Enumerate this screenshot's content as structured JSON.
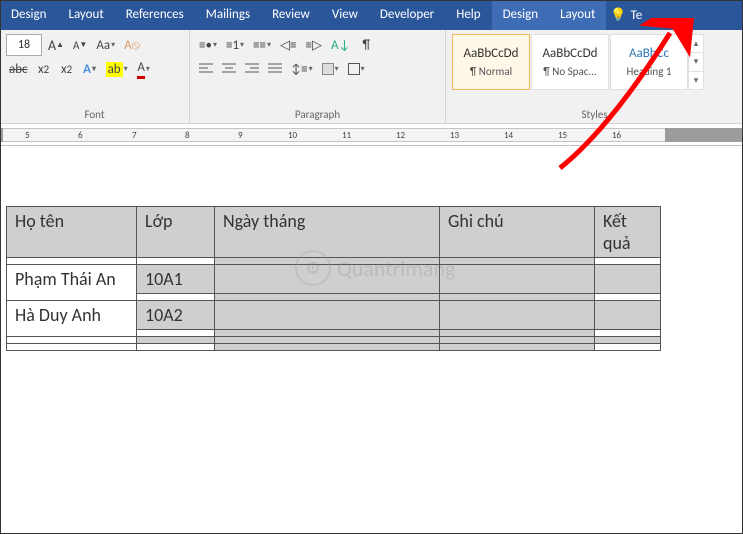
{
  "tabs": {
    "t0": "Design",
    "t1": "Layout",
    "t2": "References",
    "t3": "Mailings",
    "t4": "Review",
    "t5": "View",
    "t6": "Developer",
    "t7": "Help",
    "t8": "Design",
    "t9": "Layout",
    "tell": "Te"
  },
  "font": {
    "size": "18",
    "group_label": "Font"
  },
  "para": {
    "group_label": "Paragraph"
  },
  "styles": {
    "group_label": "Styles",
    "s0": {
      "sample": "AaBbCcDd",
      "name": "¶ Normal"
    },
    "s1": {
      "sample": "AaBbCcDd",
      "name": "¶ No Spac..."
    },
    "s2": {
      "sample": "AaBbCc",
      "name": "Heading 1"
    }
  },
  "ruler": {
    "n5": "5",
    "n6": "6",
    "n7": "7",
    "n8": "8",
    "n9": "9",
    "n10": "10",
    "n11": "11",
    "n12": "12",
    "n13": "13",
    "n14": "14",
    "n15": "15",
    "n16": "16"
  },
  "table": {
    "h0": "Họ tên",
    "h1": "Lớp",
    "h2": "Ngày tháng",
    "h3": "Ghi chú",
    "h4": "Kết quả",
    "r0c0": "Phạm Thái An",
    "r0c1": "10A1",
    "r1c0": "Hà Duy Anh",
    "r1c1": "10A2"
  },
  "watermark": "Quantrimang"
}
